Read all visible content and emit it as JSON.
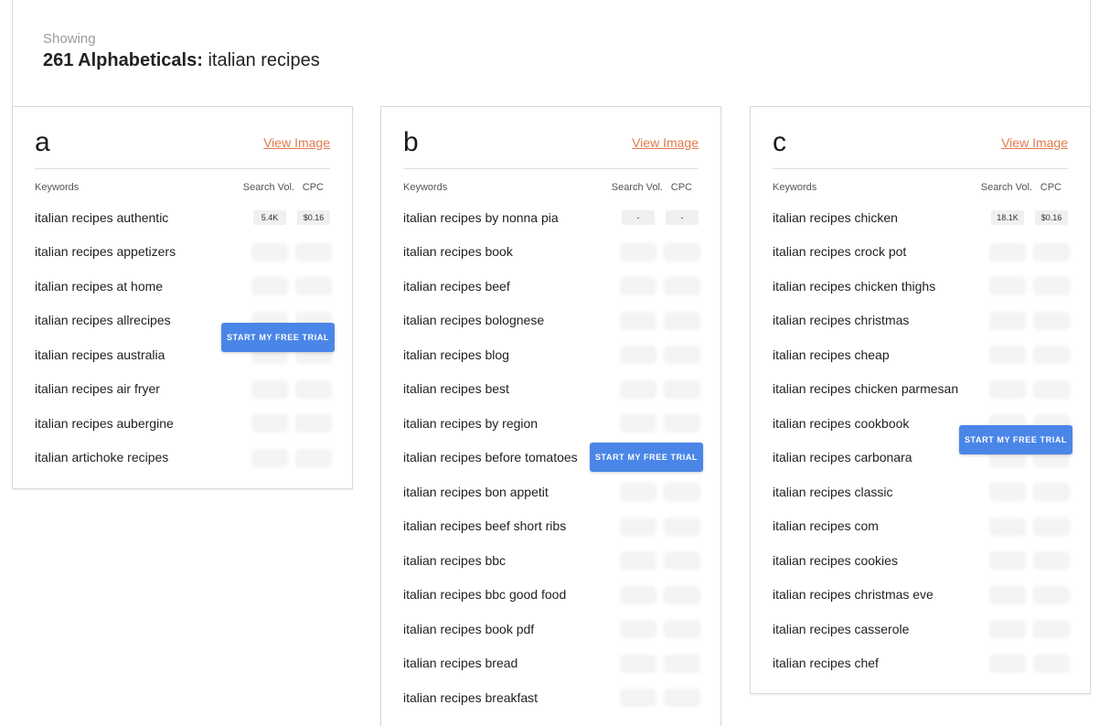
{
  "header": {
    "showing_label": "Showing",
    "count_label": "261 Alphabeticals:",
    "query": "italian recipes"
  },
  "columns": {
    "keywords": "Keywords",
    "search_vol": "Search Vol.",
    "cpc": "CPC"
  },
  "view_image_label": "View Image",
  "trial_button_label": "START MY FREE TRIAL",
  "cards": [
    {
      "letter": "a",
      "rows": [
        {
          "keyword": "italian recipes authentic",
          "search_vol": "5.4K",
          "cpc": "$0.16"
        },
        {
          "keyword": "italian recipes appetizers",
          "search_vol": "",
          "cpc": ""
        },
        {
          "keyword": "italian recipes at home",
          "search_vol": "",
          "cpc": ""
        },
        {
          "keyword": "italian recipes allrecipes",
          "search_vol": "",
          "cpc": ""
        },
        {
          "keyword": "italian recipes australia",
          "search_vol": "",
          "cpc": ""
        },
        {
          "keyword": "italian recipes air fryer",
          "search_vol": "",
          "cpc": ""
        },
        {
          "keyword": "italian recipes aubergine",
          "search_vol": "",
          "cpc": ""
        },
        {
          "keyword": "italian artichoke recipes",
          "search_vol": "",
          "cpc": ""
        }
      ]
    },
    {
      "letter": "b",
      "rows": [
        {
          "keyword": "italian recipes by nonna pia",
          "search_vol": "-",
          "cpc": "-"
        },
        {
          "keyword": "italian recipes book",
          "search_vol": "",
          "cpc": ""
        },
        {
          "keyword": "italian recipes beef",
          "search_vol": "",
          "cpc": ""
        },
        {
          "keyword": "italian recipes bolognese",
          "search_vol": "",
          "cpc": ""
        },
        {
          "keyword": "italian recipes blog",
          "search_vol": "",
          "cpc": ""
        },
        {
          "keyword": "italian recipes best",
          "search_vol": "",
          "cpc": ""
        },
        {
          "keyword": "italian recipes by region",
          "search_vol": "",
          "cpc": ""
        },
        {
          "keyword": "italian recipes before tomatoes",
          "search_vol": "",
          "cpc": ""
        },
        {
          "keyword": "italian recipes bon appetit",
          "search_vol": "",
          "cpc": ""
        },
        {
          "keyword": "italian recipes beef short ribs",
          "search_vol": "",
          "cpc": ""
        },
        {
          "keyword": "italian recipes bbc",
          "search_vol": "",
          "cpc": ""
        },
        {
          "keyword": "italian recipes bbc good food",
          "search_vol": "",
          "cpc": ""
        },
        {
          "keyword": "italian recipes book pdf",
          "search_vol": "",
          "cpc": ""
        },
        {
          "keyword": "italian recipes bread",
          "search_vol": "",
          "cpc": ""
        },
        {
          "keyword": "italian recipes breakfast",
          "search_vol": "",
          "cpc": ""
        }
      ]
    },
    {
      "letter": "c",
      "rows": [
        {
          "keyword": "italian recipes chicken",
          "search_vol": "18.1K",
          "cpc": "$0.16"
        },
        {
          "keyword": "italian recipes crock pot",
          "search_vol": "",
          "cpc": ""
        },
        {
          "keyword": "italian recipes chicken thighs",
          "search_vol": "",
          "cpc": ""
        },
        {
          "keyword": "italian recipes christmas",
          "search_vol": "",
          "cpc": ""
        },
        {
          "keyword": "italian recipes cheap",
          "search_vol": "",
          "cpc": ""
        },
        {
          "keyword": "italian recipes chicken parmesan",
          "search_vol": "",
          "cpc": ""
        },
        {
          "keyword": "italian recipes cookbook",
          "search_vol": "",
          "cpc": ""
        },
        {
          "keyword": "italian recipes carbonara",
          "search_vol": "",
          "cpc": ""
        },
        {
          "keyword": "italian recipes classic",
          "search_vol": "",
          "cpc": ""
        },
        {
          "keyword": "italian recipes com",
          "search_vol": "",
          "cpc": ""
        },
        {
          "keyword": "italian recipes cookies",
          "search_vol": "",
          "cpc": ""
        },
        {
          "keyword": "italian recipes christmas eve",
          "search_vol": "",
          "cpc": ""
        },
        {
          "keyword": "italian recipes casserole",
          "search_vol": "",
          "cpc": ""
        },
        {
          "keyword": "italian recipes chef",
          "search_vol": "",
          "cpc": ""
        }
      ]
    }
  ]
}
